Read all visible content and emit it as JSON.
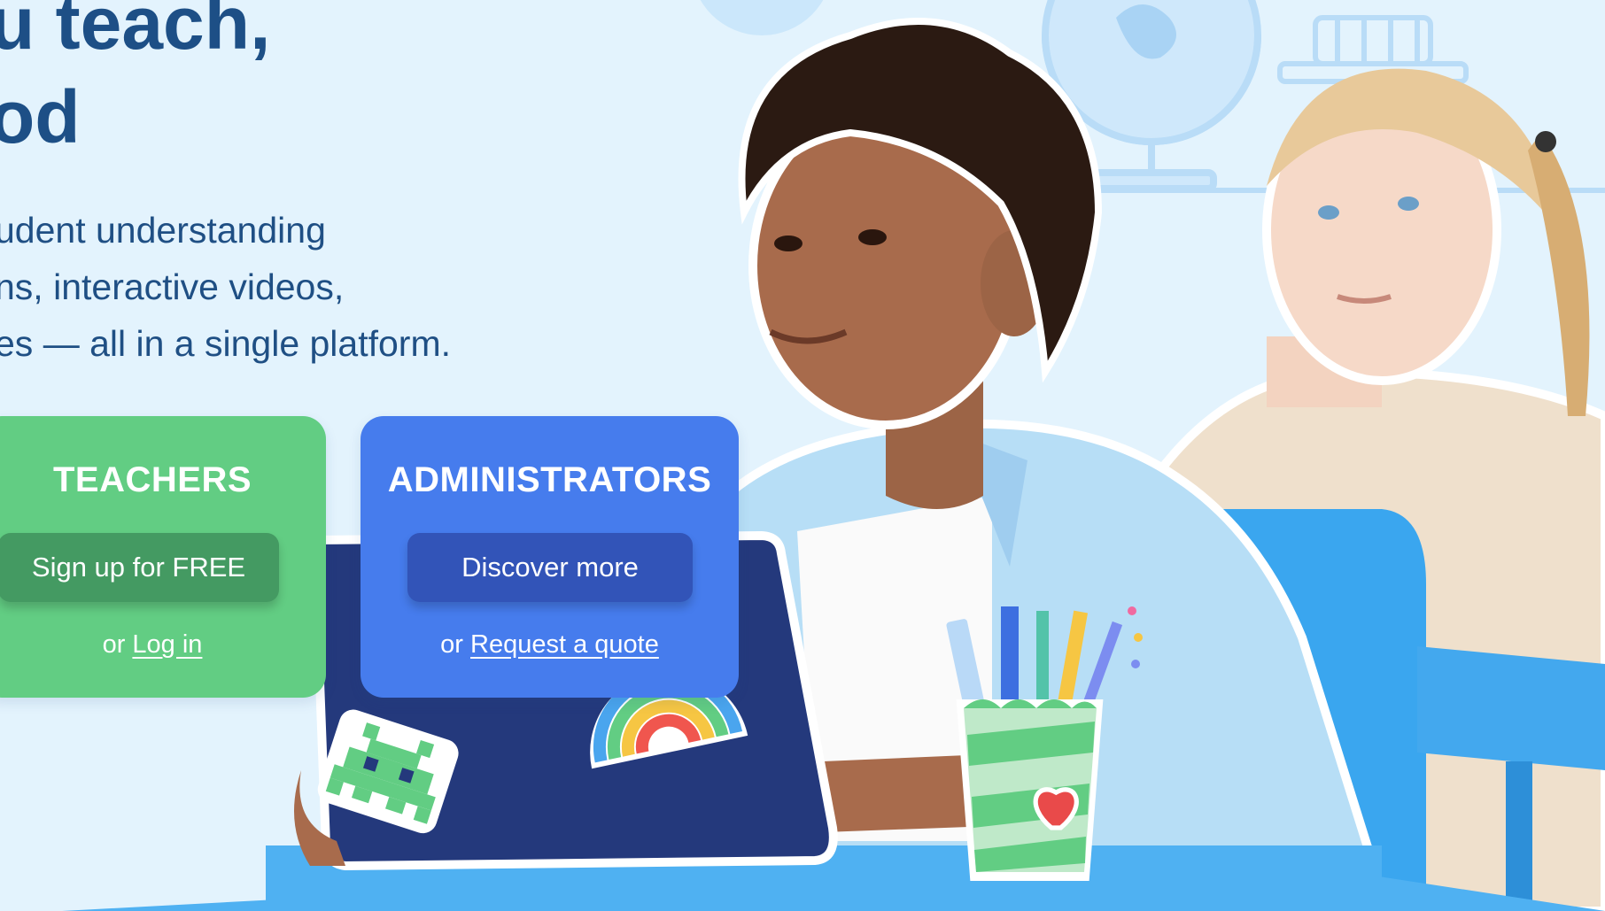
{
  "hero": {
    "headline_line1": "u teach,",
    "headline_line2": "od",
    "subtext_lines": [
      "udent understanding",
      "ns, interactive videos,",
      "es — all in a single platform."
    ]
  },
  "cards": {
    "teachers": {
      "title": "TEACHERS",
      "button_label": "Sign up for FREE",
      "alt_prefix": "or",
      "alt_link": "Log in"
    },
    "administrators": {
      "title": "ADMINISTRATORS",
      "button_label": "Discover more",
      "alt_prefix": "or",
      "alt_link": "Request a quote"
    }
  },
  "colors": {
    "background": "#e3f3fd",
    "headline": "#1d4f86",
    "teachers_card": "#62cd83",
    "teachers_button": "#449a62",
    "admin_card": "#467ced",
    "admin_button": "#3254b8",
    "laptop": "#24397c",
    "desk": "#4fb1f2"
  },
  "illustrations": [
    "globe-icon",
    "bookshelf-icon",
    "laptop-illustration",
    "space-invader-sticker",
    "rainbow-sticker",
    "pencil-cup-illustration",
    "heart-icon",
    "student-boy-photo",
    "student-girl-photo"
  ]
}
